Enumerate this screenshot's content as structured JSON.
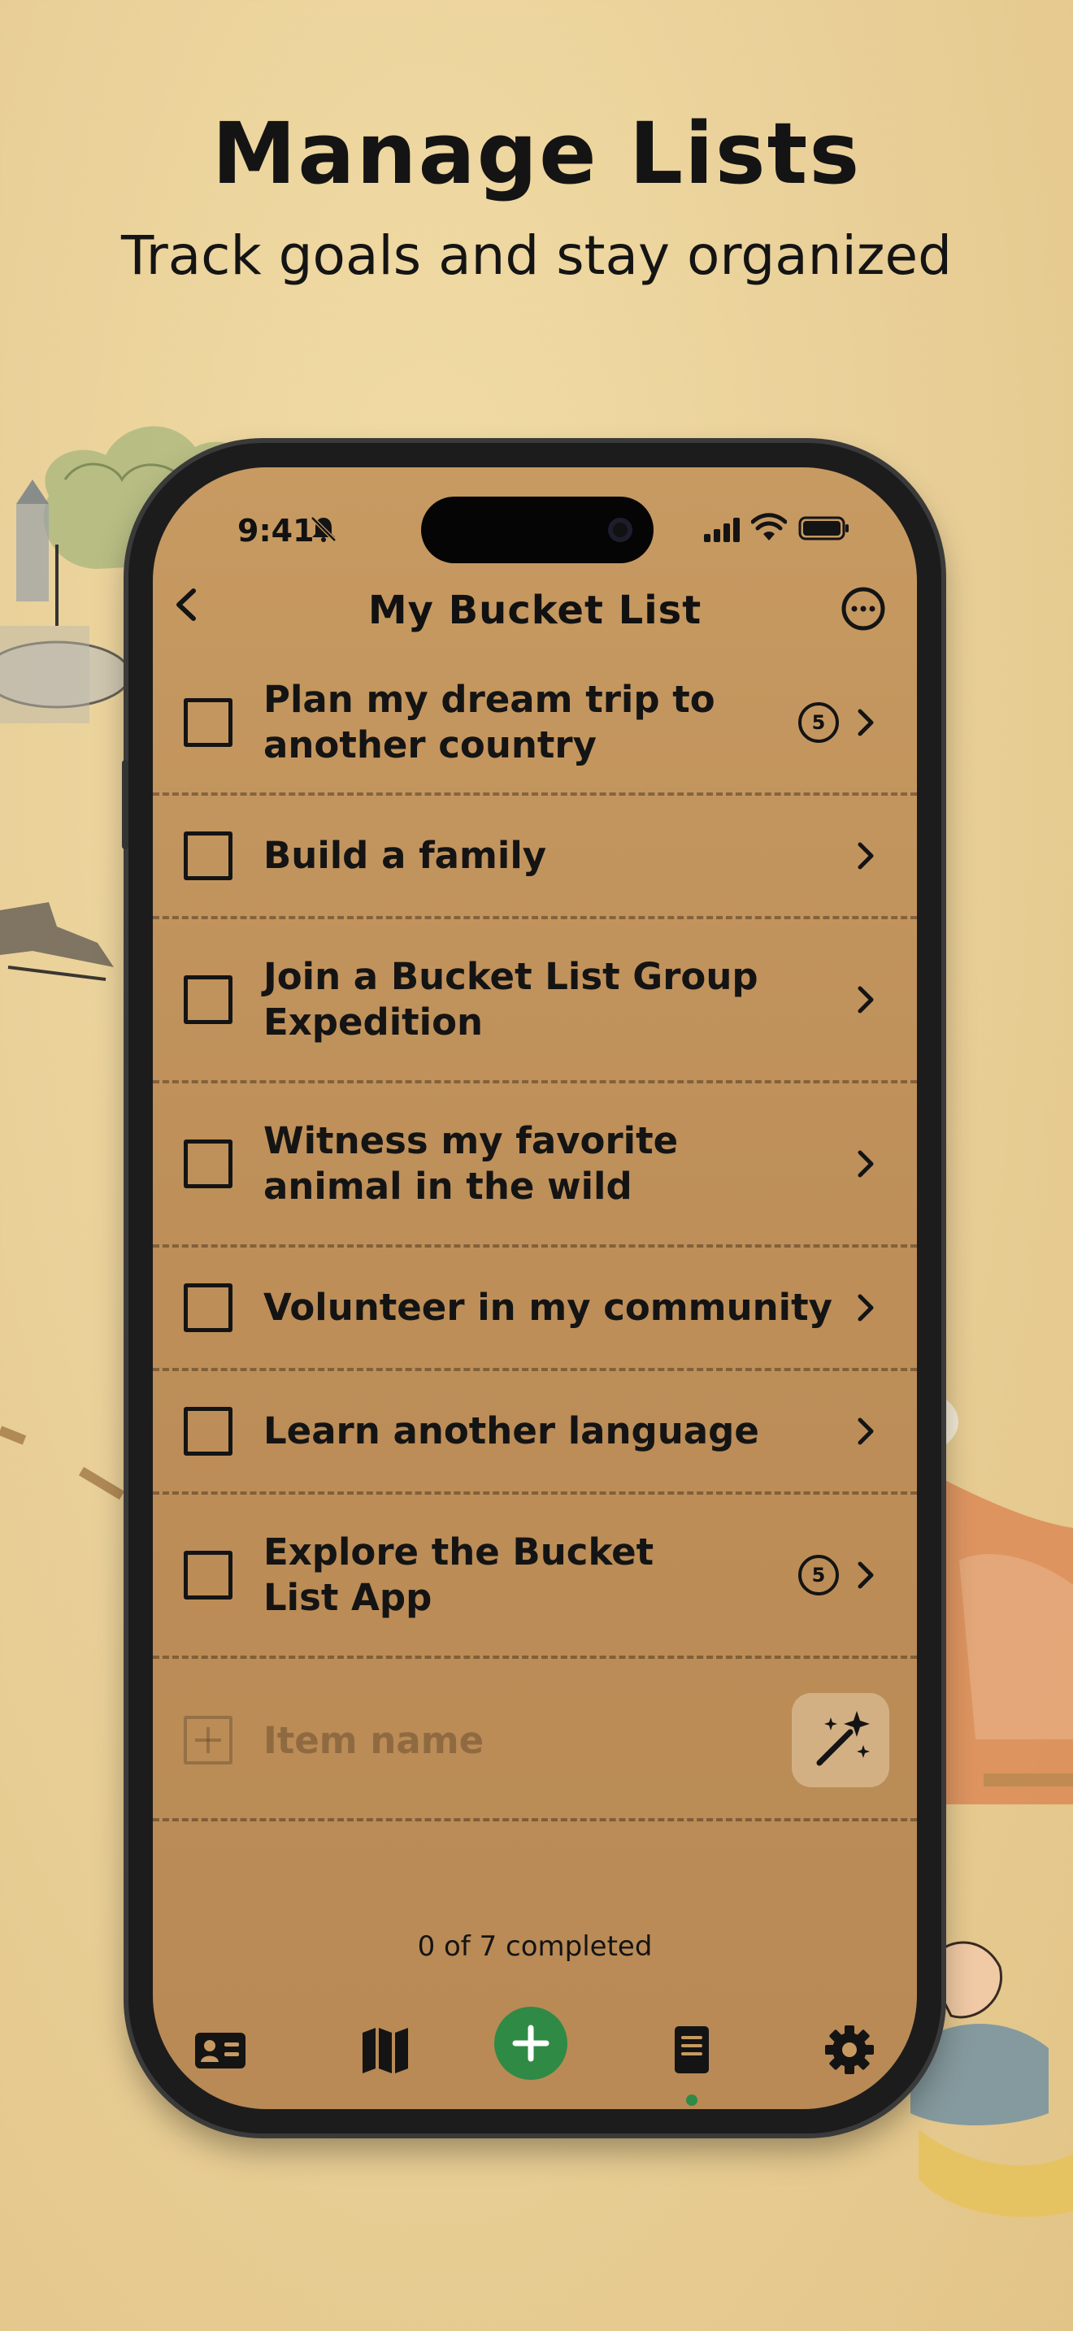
{
  "promo": {
    "headline": "Manage Lists",
    "subheadline": "Track goals and stay organized"
  },
  "status_bar": {
    "time": "9:41",
    "icons": [
      "bell-slash-icon",
      "signal-icon",
      "wifi-icon",
      "battery-icon"
    ]
  },
  "nav": {
    "title": "My Bucket List",
    "back_icon": "chevron-left-icon",
    "more_icon": "ellipsis-circle-icon"
  },
  "items": [
    {
      "label": "Plan my dream trip to another country",
      "badge": "5"
    },
    {
      "label": "Build a family",
      "badge": ""
    },
    {
      "label": "Join a Bucket List Group Expedition",
      "badge": ""
    },
    {
      "label": "Witness my favorite animal in the wild",
      "badge": ""
    },
    {
      "label": "Volunteer in my community",
      "badge": ""
    },
    {
      "label": "Learn another language",
      "badge": ""
    },
    {
      "label": "Explore the Bucket List App",
      "badge": "5"
    }
  ],
  "add_item": {
    "placeholder": "Item name",
    "magic_icon": "magic-wand-icon"
  },
  "progress": {
    "text": "0 of 7 completed",
    "completed": 0,
    "total": 7
  },
  "tabs": [
    {
      "icon": "id-card-icon"
    },
    {
      "icon": "map-icon"
    },
    {
      "icon": "plus-circle-icon"
    },
    {
      "icon": "notebook-icon",
      "selected": true
    },
    {
      "icon": "gear-icon"
    }
  ],
  "colors": {
    "background": "#ead19a",
    "screen": "#c79a62",
    "accent_green": "#2f8a46",
    "text": "#141414"
  }
}
